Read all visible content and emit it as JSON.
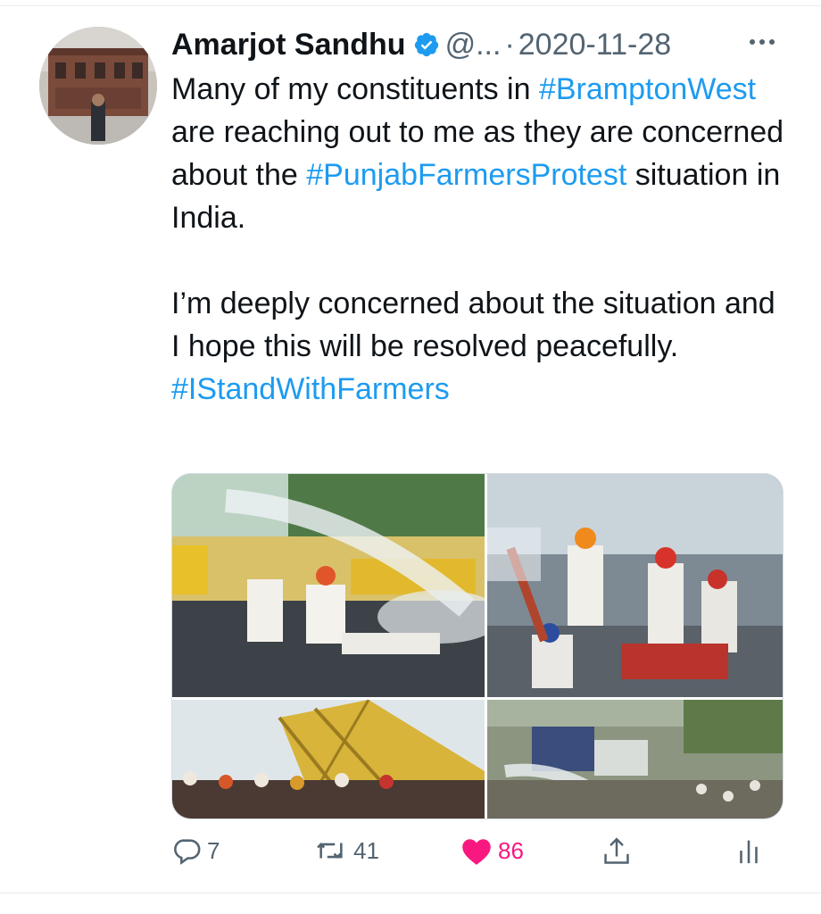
{
  "tweet": {
    "author_name": "Amarjot Sandhu",
    "handle": "@...",
    "separator": "·",
    "date": "2020-11-28",
    "paragraph1": [
      {
        "text": "Many of my constituents in "
      },
      {
        "text": "#BramptonWest",
        "hashtag": true
      },
      {
        "text": " are reaching out to me as they are concerned about the "
      },
      {
        "text": "#PunjabFarmersProtest",
        "hashtag": true
      },
      {
        "text": " situation in India."
      }
    ],
    "paragraph2": [
      {
        "text": "I’m deeply concerned about the situation and I hope this will be resolved peacefully. "
      },
      {
        "text": "#IStandWithFarmers",
        "hashtag": true
      }
    ],
    "media_count": 4
  },
  "actions": {
    "reply_count": "7",
    "retweet_count": "41",
    "like_count": "86",
    "liked": true
  },
  "icons": {
    "verified": "verified-badge-icon",
    "more": "more-dots-icon",
    "reply": "reply-icon",
    "retweet": "retweet-icon",
    "like": "heart-icon",
    "share": "share-icon",
    "stats": "analytics-icon"
  },
  "colors": {
    "accent": "#1d9bf0",
    "text": "#0f1419",
    "muted": "#536471",
    "like": "#f91880"
  }
}
